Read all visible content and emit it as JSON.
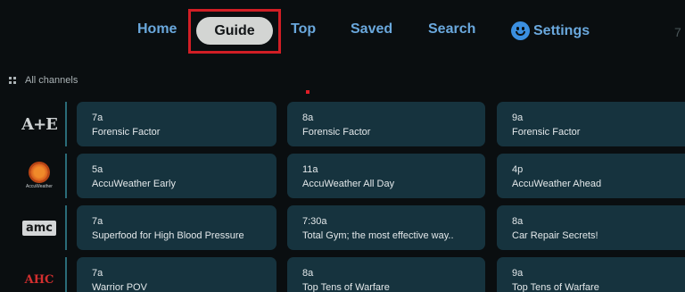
{
  "nav": {
    "home": "Home",
    "guide": "Guide",
    "top": "Top",
    "saved": "Saved",
    "search": "Search",
    "settings": "Settings",
    "extra": "7"
  },
  "guide_header": {
    "all_channels": "All channels"
  },
  "rows": [
    {
      "channel_logo": "A+E",
      "programs": [
        {
          "time": "7a",
          "title": "Forensic Factor"
        },
        {
          "time": "8a",
          "title": "Forensic Factor"
        },
        {
          "time": "9a",
          "title": "Forensic Factor"
        }
      ]
    },
    {
      "channel_logo": "AccuWeather",
      "programs": [
        {
          "time": "5a",
          "title": "AccuWeather Early"
        },
        {
          "time": "11a",
          "title": "AccuWeather All Day"
        },
        {
          "time": "4p",
          "title": "AccuWeather Ahead"
        }
      ]
    },
    {
      "channel_logo": "amc",
      "programs": [
        {
          "time": "7a",
          "title": "Superfood for High Blood Pressure"
        },
        {
          "time": "7:30a",
          "title": "Total Gym; the most effective way.."
        },
        {
          "time": "8a",
          "title": "Car Repair Secrets!"
        }
      ]
    },
    {
      "channel_logo": "AHC",
      "programs": [
        {
          "time": "7a",
          "title": "Warrior POV"
        },
        {
          "time": "8a",
          "title": "Top Tens of Warfare"
        },
        {
          "time": "9a",
          "title": "Top Tens of Warfare"
        }
      ]
    }
  ],
  "colors": {
    "accent": "#6aa8dd",
    "highlight": "#d11e25",
    "card": "#16333e"
  }
}
